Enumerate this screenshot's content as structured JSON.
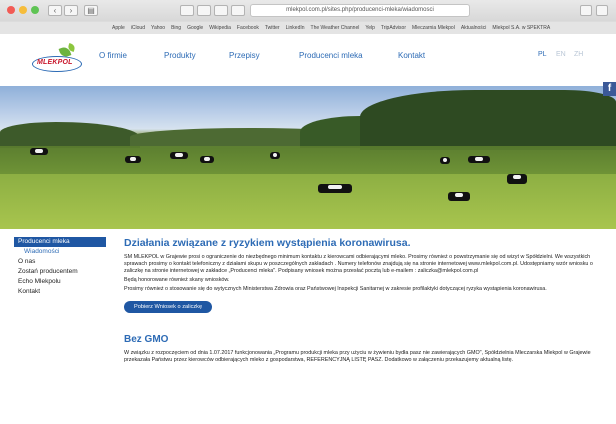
{
  "browser": {
    "address": "mlekpol.com.pl/sites.php/producenci-mleka/wiadomosci",
    "bookmarks": [
      "Apple",
      "iCloud",
      "Yahoo",
      "Bing",
      "Google",
      "Wikipedia",
      "Facebook",
      "Twitter",
      "LinkedIn",
      "The Weather Channel",
      "Yelp",
      "TripAdvisor",
      "Mleczarnia Mlekpol",
      "Aktualności",
      "Mlekpol S.A. w SPEKTRA"
    ]
  },
  "site": {
    "logo_text": "MLEKPOL",
    "nav": [
      "O firmie",
      "Produkty",
      "Przepisy",
      "Producenci mleka",
      "Kontakt"
    ],
    "languages": [
      "PL",
      "EN",
      "ZH"
    ],
    "active_language": "PL",
    "facebook_label": "f"
  },
  "sidebar": {
    "items": [
      {
        "label": "Producenci mleka",
        "state": "active"
      },
      {
        "label": "Wiadomości",
        "state": "sub"
      },
      {
        "label": "O nas",
        "state": "normal"
      },
      {
        "label": "Zostań producentem",
        "state": "normal"
      },
      {
        "label": "Echo Mlekpolu",
        "state": "normal"
      },
      {
        "label": "Kontakt",
        "state": "normal"
      }
    ]
  },
  "content": {
    "title": "Działania związane z ryzykiem wystąpienia koronawirusa.",
    "paragraphs": [
      "SM MLEKPOL w Grajewie prosi o ograniczenie do niezbędnego minimum kontaktu z kierowcami odbierającymi mleko. Prosimy również o powstrzymanie się od wizyt w Spółdzielni. We wszystkich sprawach prosimy o kontakt telefoniczny z działami skupu w poszczególnych zakładach . Numery telefonów znajdują się na stronie internetowej www.mlekpol.com.pl. Udostępniamy wzór wniosku o zaliczkę na stronie internetowej w zakładce „Producenci mleka\". Podpisany wniosek można przesłać pocztą lub e-mailem : zaliczka@mlekpol.com.pl",
      "Będą honorowane również skany wniosków.",
      "Prosimy również o stosowanie się do wytycznych Ministerstwa Zdrowia oraz Państwowej Inspekcji Sanitarnej w zakresie profilaktyki dotyczącej ryzyka wystąpienia koronawirusa."
    ],
    "button_label": "Pobierz Wniosek o zaliczkę",
    "section2_title": "Bez GMO",
    "section2_paragraph": "W związku z rozpoczęciem od dnia 1.07.2017 funkcjonowania „Programu produkcji mleka przy użyciu w żywieniu bydła pasz nie zawierających GMO\", Spółdzielnia Mleczarska Mlekpol w Grajewie przekazała Państwu przez kierowców odbierających mleko z gospodarstwa, REFERENCYJNĄ LISTĘ PASZ. Dodatkowo w załączeniu przekazujemy aktualną listę."
  },
  "colors": {
    "brand_blue": "#2d6bb5",
    "nav_active_bg": "#1f57a3",
    "logo_red": "#c8162b"
  }
}
